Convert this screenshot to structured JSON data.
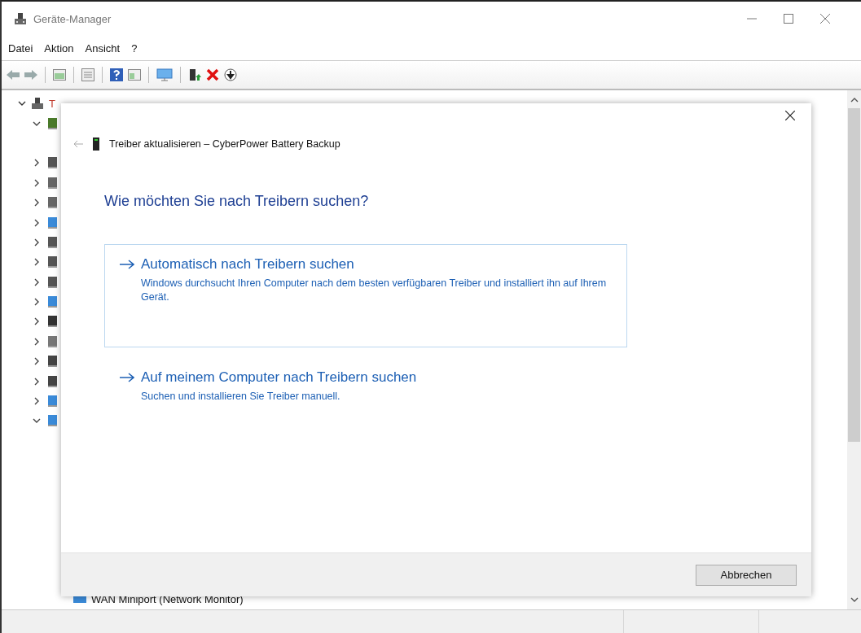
{
  "window": {
    "title": "Geräte-Manager"
  },
  "menu": [
    "Datei",
    "Aktion",
    "Ansicht",
    "?"
  ],
  "tree": {
    "label": "T",
    "expanded": true,
    "children": [
      {
        "expanded": true
      },
      {
        "expanded": false
      },
      {
        "expanded": false
      },
      {
        "expanded": false
      },
      {
        "expanded": false
      },
      {
        "expanded": false
      },
      {
        "expanded": false
      },
      {
        "expanded": false
      },
      {
        "expanded": false
      },
      {
        "expanded": false
      },
      {
        "expanded": false
      },
      {
        "expanded": false
      },
      {
        "expanded": false
      },
      {
        "expanded": false
      },
      {
        "expanded": true,
        "children": [
          {
            "label": "WAN Miniport (Network Monitor)"
          }
        ]
      }
    ]
  },
  "dialog": {
    "title": "Treiber aktualisieren – CyberPower Battery Backup",
    "heading": "Wie möchten Sie nach Treibern suchen?",
    "options": [
      {
        "title": "Automatisch nach Treibern suchen",
        "description": "Windows durchsucht Ihren Computer nach dem besten verfügbaren Treiber und installiert ihn auf Ihrem Gerät.",
        "focused": true
      },
      {
        "title": "Auf meinem Computer nach Treibern suchen",
        "description": "Suchen und installieren Sie Treiber manuell.",
        "focused": false
      }
    ],
    "buttons": [
      "Abbrechen"
    ]
  }
}
